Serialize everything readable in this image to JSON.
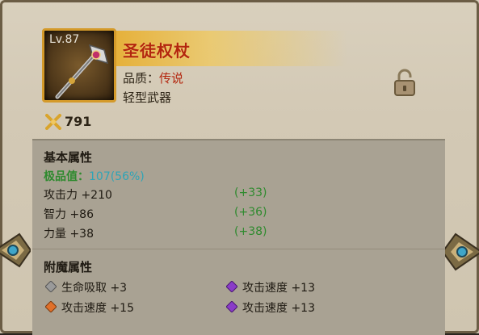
{
  "item": {
    "level": "Lv.87",
    "name": "圣徒权杖",
    "quality_label": "品质：",
    "quality_value": "传说",
    "type": "轻型武器",
    "power": "791",
    "locked": false
  },
  "base_attributes": {
    "title": "基本属性",
    "extreme_label": "极品值：",
    "extreme_value": "107(56%)",
    "stats": [
      {
        "label": "攻击力 +210",
        "bonus": "(+33)"
      },
      {
        "label": "智力 +86",
        "bonus": "(+36)"
      },
      {
        "label": "力量 +38",
        "bonus": "(+38)"
      }
    ]
  },
  "enchant_attributes": {
    "title": "附魔属性",
    "items": [
      {
        "label": "生命吸取 +3",
        "gem_color": "#9a9a9a"
      },
      {
        "label": "攻击速度 +13",
        "gem_color": "#8a3cc8"
      },
      {
        "label": "攻击速度 +15",
        "gem_color": "#e0702a"
      },
      {
        "label": "攻击速度 +13",
        "gem_color": "#8a3cc8"
      }
    ]
  },
  "colors": {
    "legend_red": "#b3260e",
    "bonus_green": "#2e8a2e",
    "extreme_cyan": "#2ea4b7",
    "frame_gold": "#d49a2a"
  },
  "icons": {
    "weapon": "scepter-icon",
    "lock": "unlocked-padlock-icon",
    "power": "crossed-swords-icon",
    "side_ornaments": "ornament-icon"
  }
}
